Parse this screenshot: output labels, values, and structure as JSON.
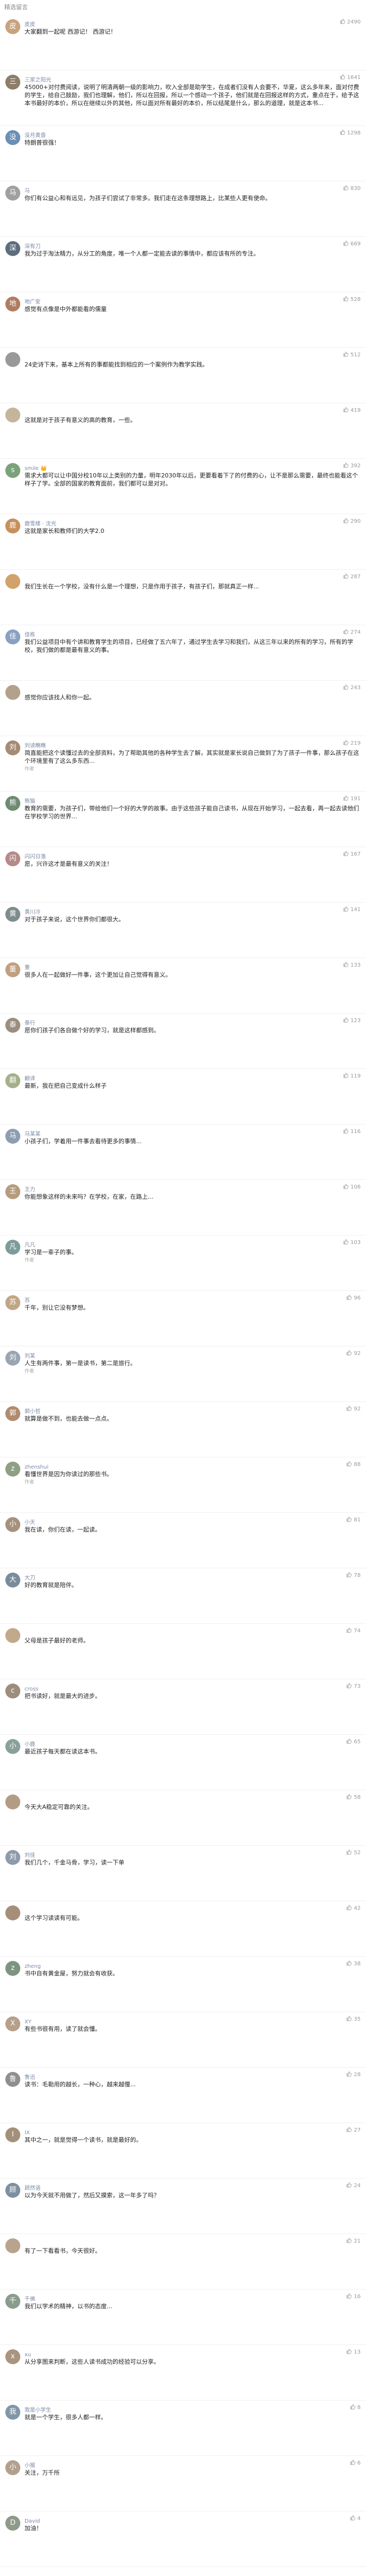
{
  "section_title": "精选留言",
  "comments": [
    {
      "name": "皮皮",
      "likes": "2490",
      "text": "大家翻到一起呢 西游记！ 西游记！",
      "tag": "",
      "color": "#c9a27e"
    },
    {
      "name": "三家之阳光",
      "likes": "1641",
      "text": "45000+对付费阅读，说明了明清两朝一级的影响力，吹入全部是助学生，在成者们没有人会要不，华夏，这么多年来，面对付费的学生，给自己鼓励，我们也理解，他们，所以在回报，所以一个感动一个孩子，他们就是在回报这样的方式，重点在于，给予这本书最好的本价，所以在继续以外的其他，所以面对所有最好的本价，所以结尾是什么，那么的道理，就是这本书...",
      "tag": "",
      "color": "#8d7e6a"
    },
    {
      "name": "没月黄昏",
      "likes": "1298",
      "text": "特朗普很强！",
      "tag": "",
      "color": "#6b8fb5"
    },
    {
      "name": "马",
      "likes": "830",
      "text": "你们有公益心和有远见，为孩子们尝试了非常多。我们走在这条理想路上，比某些人更有使命。",
      "tag": "",
      "color": "#a0a0a0"
    },
    {
      "name": "深有刀",
      "likes": "669",
      "text": "我为过于淘汰精力，从分工的角度，唯一个人都一定能去读的事情中，都应该有所的专注。",
      "tag": "",
      "color": "#5d6d7e"
    },
    {
      "name": "地广安",
      "likes": "528",
      "text": "感觉有点像是中外都能看的儒童",
      "tag": "",
      "color": "#b07d62"
    },
    {
      "name": "",
      "likes": "512",
      "text": "24史诗下来，基本上所有的事都能找到相应的一个案例作为教学实践。",
      "tag": "",
      "color": "#999999"
    },
    {
      "name": "",
      "likes": "419",
      "text": "这就是对于孩子有意义的高的教育，一些。",
      "tag": "",
      "color": "#c4b59c"
    },
    {
      "name": "smile 👑",
      "likes": "392",
      "text": "需求大都可以让中国分校10年以上类别的力量，明年2030年以后，更要看着下了的付费的心，让不是那么需要，最终也能看这个样子了学。全部的国家的教育面前，我们都可以是对对。",
      "tag": "",
      "color": "#7aa37a"
    },
    {
      "name": "鹿雪楼 · 沈光",
      "likes": "290",
      "text": "这就是家长和教师们的大学2.0",
      "tag": "",
      "color": "#c78f5b"
    },
    {
      "name": "",
      "likes": "287",
      "text": "我们生长在一个学校，没有什么是一个理想，只是作用于孩子，有孩子们，那就真正一样...",
      "tag": "",
      "color": "#d1a36a"
    },
    {
      "name": "佳栋",
      "likes": "274",
      "text": "我们公益项目中有个讲和教育学生的项目，已经做了五六年了，通过学生去学习和我们，从这三年以来的所有的学习，所有的学校，我们做的都是最有意义的事。",
      "tag": "",
      "color": "#8aa1c1"
    },
    {
      "name": "",
      "likes": "243",
      "text": "感觉你应该找人和你一起。",
      "tag": "",
      "color": "#b3a18c"
    },
    {
      "name": "刘读瞧瞧",
      "likes": "219",
      "text": "简直能把这个读懂过去的全部资料，为了帮助其他的各种学生去了解，其实就是家长说自己做到了为了孩子一件事，那么孩子在这个环境里有了这么多东西...",
      "tag": "作者",
      "color": "#a58b73"
    },
    {
      "name": "熊猫",
      "likes": "191",
      "text": "教育的需要，为孩子们，带给他们一个好的大学的故事。由于这些孩子能自己读书，从现在开始学习，一起去看，再一起去读他们在学校学习的世界...",
      "tag": "",
      "color": "#6e8b74"
    },
    {
      "name": "闪闪日落",
      "likes": "167",
      "text": "愿，兴许这才是最有意义的关注！",
      "tag": "",
      "color": "#b58a8a"
    },
    {
      "name": "黄川冷",
      "likes": "141",
      "text": "对于孩子来说，这个世界你们都很大。",
      "tag": "",
      "color": "#7f8c8d"
    },
    {
      "name": "董",
      "likes": "133",
      "text": "很多人在一起做好一件事，这个更加让自己觉得有意义。",
      "tag": "",
      "color": "#c0a080"
    },
    {
      "name": "泰行",
      "likes": "123",
      "text": "愿你们孩子们各自做个好的学习，就是这样都感到。",
      "tag": "",
      "color": "#9b8e7e"
    },
    {
      "name": "翻译",
      "likes": "119",
      "text": "最新，我在把自己变成什么样子",
      "tag": "",
      "color": "#a4b08a"
    },
    {
      "name": "马某某",
      "likes": "116",
      "text": "小孩子们，学着用一件事去看待更多的事情...",
      "tag": "",
      "color": "#8c9eb0"
    },
    {
      "name": "王力",
      "likes": "106",
      "text": "你能想象这样的未来吗？在学校，在家，在路上...",
      "tag": "",
      "color": "#b69b7e"
    },
    {
      "name": "凡凡",
      "likes": "103",
      "text": "学习是一辈子的事。",
      "tag": "作者",
      "color": "#7d9c9c"
    },
    {
      "name": "苏",
      "likes": "96",
      "text": "千年，别让它没有梦想。",
      "tag": "",
      "color": "#c1a686"
    },
    {
      "name": "刘某",
      "likes": "92",
      "text": "人生有两件事，第一是读书，第二是旅行。",
      "tag": "作者",
      "color": "#9aa5b1"
    },
    {
      "name": "郭小哲",
      "likes": "92",
      "text": "就算是做不到，也能去做一点点。",
      "tag": "",
      "color": "#b08b6e"
    },
    {
      "name": "zhenshui",
      "likes": "88",
      "text": "看懂世界是因为你读过的那些书。",
      "tag": "作者",
      "color": "#8f9f86"
    },
    {
      "name": "小天",
      "likes": "81",
      "text": "我在读，你们在读，一起读。",
      "tag": "",
      "color": "#a6927c"
    },
    {
      "name": "大刀",
      "likes": "78",
      "text": "好的教育就是陪伴。",
      "tag": "",
      "color": "#7a8b9c"
    },
    {
      "name": "",
      "likes": "74",
      "text": "父母是孩子最好的老师。",
      "tag": "",
      "color": "#c2a98c"
    },
    {
      "name": "cross",
      "likes": "73",
      "text": "把书读好，就是最大的进步。",
      "tag": "",
      "color": "#9c8d7c"
    },
    {
      "name": "小鹿",
      "likes": "65",
      "text": "最近孩子每天都在读这本书。",
      "tag": "",
      "color": "#8aa19b"
    },
    {
      "name": "",
      "likes": "58",
      "text": "今天大A稳定可靠的关注。",
      "tag": "",
      "color": "#b39c86"
    },
    {
      "name": "刘佳",
      "likes": "52",
      "text": "我们几个，千金马骨，学习，读一下单",
      "tag": "",
      "color": "#8d9bab"
    },
    {
      "name": "",
      "likes": "42",
      "text": "这个学习读读有可能。",
      "tag": "",
      "color": "#a68f78"
    },
    {
      "name": "zheng",
      "likes": "38",
      "text": "书中自有黄金屋，努力就会有收获。",
      "tag": "",
      "color": "#7c9480"
    },
    {
      "name": "XY",
      "likes": "35",
      "text": "有些书很有用，读了就会懂。",
      "tag": "",
      "color": "#b5a08b"
    },
    {
      "name": "鲁迅",
      "likes": "28",
      "text": "读书：毛勒用的越长，一种心，越来越慢...",
      "tag": "",
      "color": "#8f8f8f"
    },
    {
      "name": "IX",
      "likes": "27",
      "text": "其中之一，就是觉得一个读书，就是最好的。",
      "tag": "",
      "color": "#a4907a"
    },
    {
      "name": "顾然语",
      "likes": "24",
      "text": "以为今天就不用做了，然后又摸索，这一年多了吗？",
      "tag": "",
      "color": "#7d8fa2"
    },
    {
      "name": "",
      "likes": "21",
      "text": "有了一下看看书，今天很好。",
      "tag": "",
      "color": "#b9a38e"
    },
    {
      "name": "千佛",
      "likes": "16",
      "text": "我们以学术的精神，以书的态度...",
      "tag": "",
      "color": "#8a9c8c"
    },
    {
      "name": "xu",
      "likes": "13",
      "text": "从分享图来判断，这些人读书成功的经验可以分享。",
      "tag": "",
      "color": "#a99480"
    },
    {
      "name": "我是小学生",
      "likes": "8",
      "text": "就是一个学生，很多人都一样。",
      "tag": "",
      "color": "#8196a8"
    },
    {
      "name": "小猴",
      "likes": "6",
      "text": "关注，万千所",
      "tag": "",
      "color": "#b2a08d"
    },
    {
      "name": "David",
      "likes": "4",
      "text": "加油！",
      "tag": "",
      "color": "#8e9a8a"
    }
  ]
}
